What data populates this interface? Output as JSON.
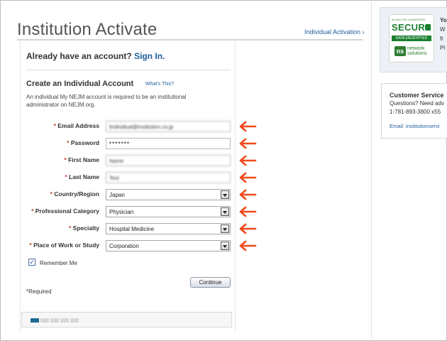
{
  "header": {
    "title": "Institution Activate",
    "individual_activation_link": "Individual Activation ›"
  },
  "account": {
    "already_text": "Already have an account?",
    "sign_in_link": "Sign In."
  },
  "create": {
    "heading": "Create an Individual Account",
    "whats_this_link": "What's This?",
    "description": "An individual My NEJM account is required to be an institutional administrator on NEJM.org."
  },
  "form": {
    "required_mark": "*",
    "fields": [
      {
        "label": "Email Address",
        "value": "lindividual@institution.co.jp",
        "type": "text"
      },
      {
        "label": "Password",
        "value": "•••••••",
        "type": "password"
      },
      {
        "label": "First Name",
        "value": "Name",
        "type": "text"
      },
      {
        "label": "Last Name",
        "value": "Test",
        "type": "text"
      },
      {
        "label": "Country/Region",
        "value": "Japan",
        "type": "select"
      },
      {
        "label": "Professional Category",
        "value": "Physician",
        "type": "select"
      },
      {
        "label": "Specialty",
        "value": "Hospital Medicine",
        "type": "select"
      },
      {
        "label": "Place of Work or Study",
        "value": "Corporation",
        "type": "select"
      }
    ],
    "remember_me": {
      "label": "Remember Me",
      "checked": true
    },
    "continue_label": "Continue",
    "required_note": "*Required"
  },
  "progress": {
    "total_steps": 5,
    "current_step": 1
  },
  "secure_seal": {
    "guarantee_text": "$1 MILLION GUARANTEE",
    "secure_text": "SECURE",
    "encrypted_text": "DATA ENCRYPTED",
    "ns_text": "ns",
    "network_text_1": "network",
    "network_text_2": "solutions",
    "brand_color": "#1a7f2e"
  },
  "right_truncated": [
    "Yo",
    "W",
    "fr",
    "Pl"
  ],
  "customer_service": {
    "title": "Customer Service",
    "line1": "Questions? Need adv",
    "line2": "1-781-893-3800 x55",
    "email": "Email: institutionservi"
  },
  "colors": {
    "link": "#1f5e9a",
    "arrow": "#f04a1a",
    "progress_active": "#1f6a95"
  }
}
